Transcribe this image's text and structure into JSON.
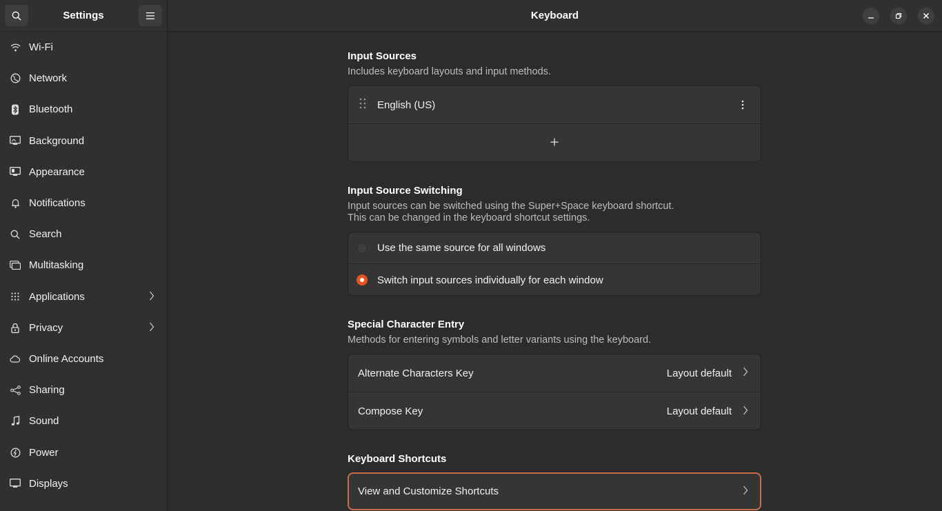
{
  "sidebar": {
    "title": "Settings",
    "items": [
      {
        "label": "Wi-Fi",
        "icon": "wifi-icon"
      },
      {
        "label": "Network",
        "icon": "network-icon"
      },
      {
        "label": "Bluetooth",
        "icon": "bluetooth-icon"
      },
      {
        "label": "Background",
        "icon": "background-icon"
      },
      {
        "label": "Appearance",
        "icon": "appearance-icon"
      },
      {
        "label": "Notifications",
        "icon": "bell-icon"
      },
      {
        "label": "Search",
        "icon": "search-icon"
      },
      {
        "label": "Multitasking",
        "icon": "multitasking-icon"
      },
      {
        "label": "Applications",
        "icon": "grid-icon",
        "has_arrow": true
      },
      {
        "label": "Privacy",
        "icon": "lock-icon",
        "has_arrow": true
      },
      {
        "label": "Online Accounts",
        "icon": "cloud-icon"
      },
      {
        "label": "Sharing",
        "icon": "share-icon"
      },
      {
        "label": "Sound",
        "icon": "music-note-icon"
      },
      {
        "label": "Power",
        "icon": "power-icon"
      },
      {
        "label": "Displays",
        "icon": "display-icon"
      }
    ]
  },
  "header": {
    "title": "Keyboard"
  },
  "input_sources": {
    "title": "Input Sources",
    "description": "Includes keyboard layouts and input methods.",
    "sources": [
      "English (US)"
    ],
    "add_label": "+"
  },
  "switching": {
    "title": "Input Source Switching",
    "description_line1": "Input sources can be switched using the Super+Space keyboard shortcut.",
    "description_line2": "This can be changed in the keyboard shortcut settings.",
    "options": [
      {
        "label": "Use the same source for all windows",
        "selected": false
      },
      {
        "label": "Switch input sources individually for each window",
        "selected": true
      }
    ]
  },
  "special": {
    "title": "Special Character Entry",
    "description": "Methods for entering symbols and letter variants using the keyboard.",
    "rows": [
      {
        "label": "Alternate Characters Key",
        "value": "Layout default"
      },
      {
        "label": "Compose Key",
        "value": "Layout default"
      }
    ]
  },
  "shortcuts": {
    "title": "Keyboard Shortcuts",
    "row_label": "View and Customize Shortcuts"
  },
  "colors": {
    "accent": "#e95420",
    "background": "#2c2c2c",
    "card": "#353535"
  }
}
